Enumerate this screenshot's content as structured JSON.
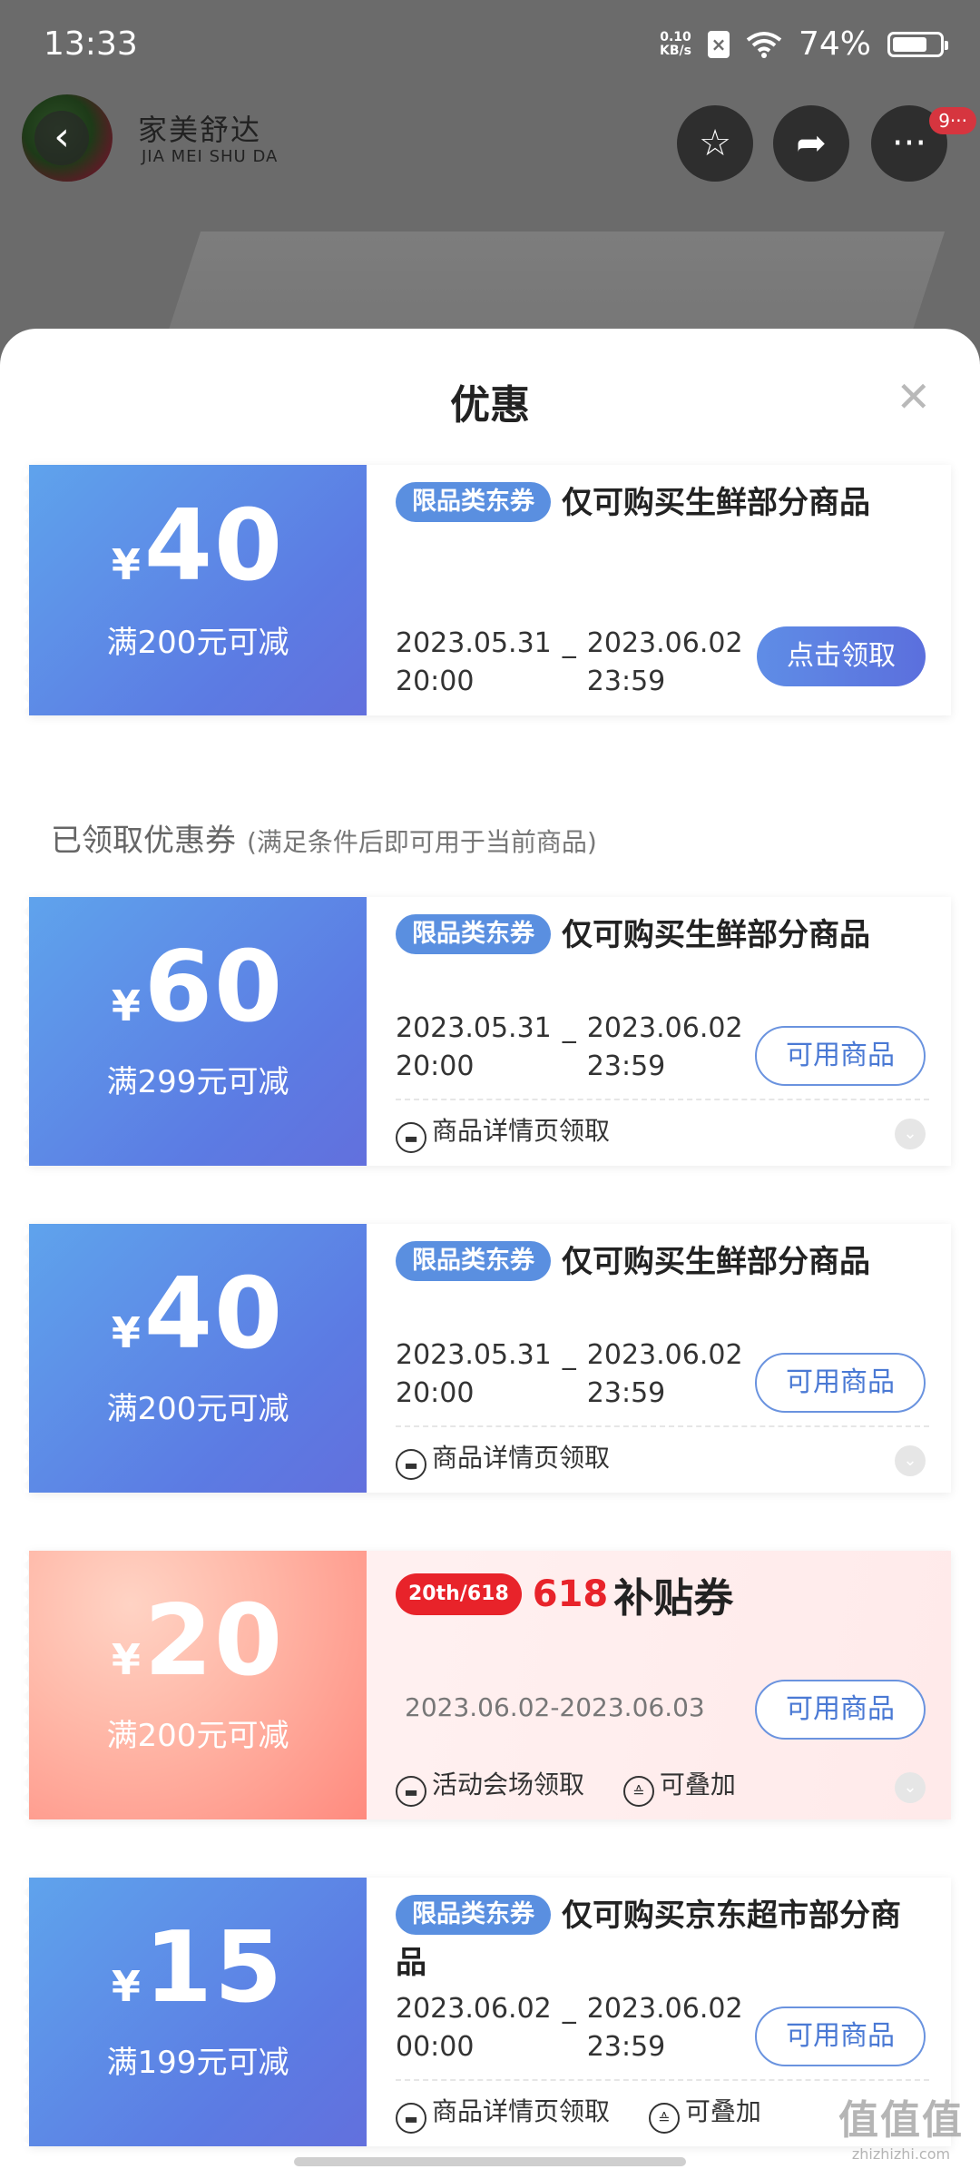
{
  "status_bar": {
    "time": "13:33",
    "net_speed_value": "0.10",
    "net_speed_unit": "KB/s",
    "battery": "74%",
    "battery_level": 0.74
  },
  "header": {
    "brand_cn": "家美舒达",
    "brand_en": "JIA MEI SHU DA",
    "badge": "9···"
  },
  "sheet": {
    "title": "优惠",
    "section_title": "已领取优惠券",
    "section_sub": "(满足条件后即可用于当前商品)"
  },
  "claimable_coupon": {
    "currency": "¥",
    "amount": "40",
    "condition": "满200元可减",
    "tag": "限品类东券",
    "title": "仅可购买生鲜部分商品",
    "start_date": "2023.05.31",
    "start_time": "20:00",
    "separator": "_",
    "end_date": "2023.06.02",
    "end_time": "23:59",
    "button": "点击领取"
  },
  "claimed_coupons": [
    {
      "currency": "¥",
      "amount": "60",
      "condition": "满299元可减",
      "tag": "限品类东券",
      "title": "仅可购买生鲜部分商品",
      "start_date": "2023.05.31",
      "start_time": "20:00",
      "separator": "_",
      "end_date": "2023.06.02",
      "end_time": "23:59",
      "button": "可用商品",
      "source": "商品详情页领取"
    },
    {
      "currency": "¥",
      "amount": "40",
      "condition": "满200元可减",
      "tag": "限品类东券",
      "title": "仅可购买生鲜部分商品",
      "start_date": "2023.05.31",
      "start_time": "20:00",
      "separator": "_",
      "end_date": "2023.06.02",
      "end_time": "23:59",
      "button": "可用商品",
      "source": "商品详情页领取"
    },
    {
      "currency": "¥",
      "amount": "20",
      "condition": "满200元可减",
      "promo_logo": "20th/618",
      "promo_num": "618",
      "promo_name": "补贴券",
      "date_range": "2023.06.02-2023.06.03",
      "button": "可用商品",
      "source": "活动会场领取",
      "stackable": "可叠加"
    },
    {
      "currency": "¥",
      "amount": "15",
      "condition": "满199元可减",
      "tag": "限品类东券",
      "title": "仅可购买京东超市部分商品",
      "start_date": "2023.06.02",
      "start_time": "00:00",
      "separator": "_",
      "end_date": "2023.06.02",
      "end_time": "23:59",
      "button": "可用商品",
      "source": "商品详情页领取",
      "stackable": "可叠加"
    }
  ],
  "watermark": {
    "big": "值值值",
    "small": "zhizhizhi.com"
  },
  "colors": {
    "coupon_blue": "#5c7be3",
    "button_blue": "#4a79d4",
    "promo_red": "#e8232a",
    "badge_red": "#d6353f"
  }
}
